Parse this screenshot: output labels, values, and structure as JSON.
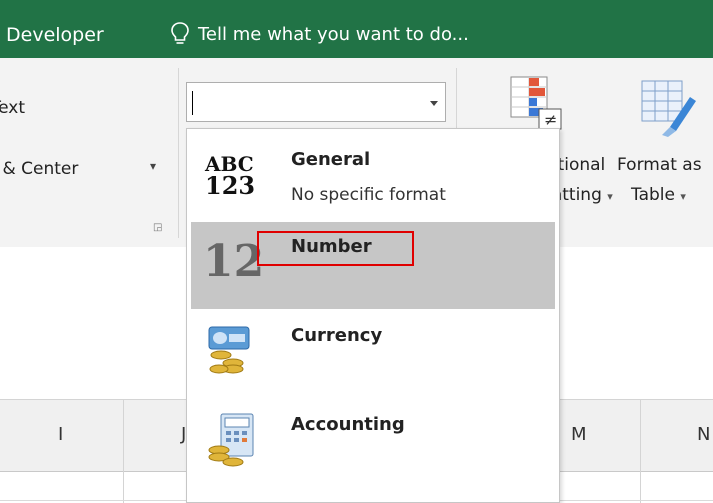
{
  "title_bar": {
    "tab_label": "Developer",
    "tell_me": "Tell me what you want to do..."
  },
  "ribbon": {
    "wrap_text": "Wrap Text",
    "merge_center": "Merge & Center",
    "conditional_formatting": {
      "line1": "Conditional",
      "line2": "Formatting"
    },
    "format_as_table": {
      "line1": "Format as",
      "line2": "Table"
    },
    "number_format_value": ""
  },
  "number_format_menu": {
    "items": [
      {
        "label": "General",
        "description": "No specific format",
        "icon": "abc-123-icon",
        "icon_line1": "ABC",
        "icon_line2": "123"
      },
      {
        "label": "Number",
        "description": "",
        "icon": "number-12-icon",
        "icon_text": "12",
        "selected": true
      },
      {
        "label": "Currency",
        "description": "",
        "icon": "currency-icon"
      },
      {
        "label": "Accounting",
        "description": "",
        "icon": "accounting-icon"
      }
    ]
  },
  "grid": {
    "columns": [
      "I",
      "J",
      "M",
      "N"
    ]
  },
  "colors": {
    "title_bar": "#217346",
    "selected_item": "#c6c6c6",
    "highlight": "#e00000"
  }
}
